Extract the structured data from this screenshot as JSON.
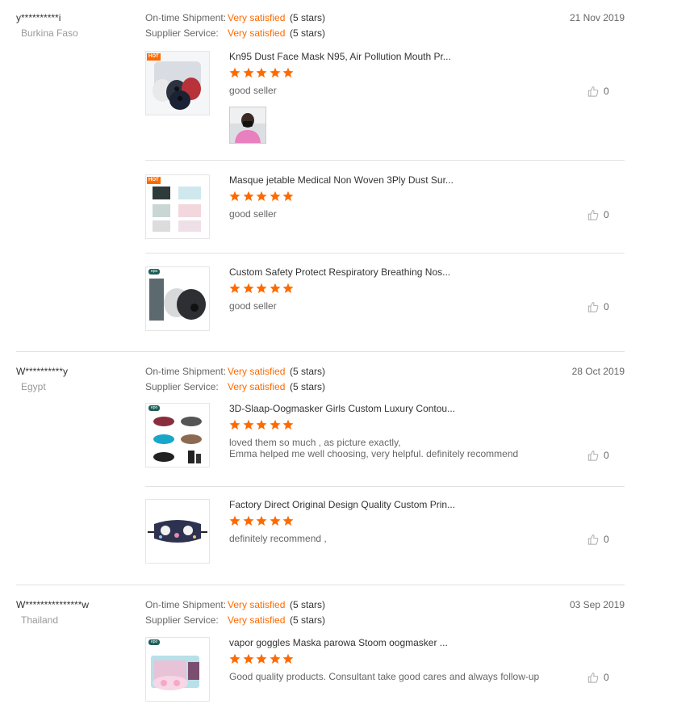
{
  "colors": {
    "accent": "#ff6a00",
    "star": "#ff6a00",
    "divider": "#e2e2e2"
  },
  "reviews": [
    {
      "buyer": "y**********i",
      "country": "Burkina Faso",
      "date": "21 Nov 2019",
      "shipment_label": "On-time Shipment:",
      "shipment_value": "Very satisfied",
      "shipment_stars": "(5 stars)",
      "service_label": "Supplier Service:",
      "service_value": "Very satisfied",
      "service_stars": "(5 stars)",
      "products": [
        {
          "title": "Kn95 Dust Face Mask N95, Air Pollution Mouth Pr...",
          "rating": 5,
          "comment": [
            "good seller"
          ],
          "likes": "0",
          "badge": "HOT",
          "thumb_icon": "face-mask-product-image",
          "has_photo": true
        },
        {
          "title": "Masque jetable Medical Non Woven 3Ply Dust Sur...",
          "rating": 5,
          "comment": [
            "good seller"
          ],
          "likes": "0",
          "badge": "HOT",
          "thumb_icon": "disposable-mask-product-image"
        },
        {
          "title": "Custom Safety Protect Respiratory Breathing Nos...",
          "rating": 5,
          "comment": [
            "good seller"
          ],
          "likes": "0",
          "badge": "epo",
          "thumb_icon": "respirator-mask-product-image"
        }
      ]
    },
    {
      "buyer": "W**********y",
      "country": "Egypt",
      "date": "28 Oct 2019",
      "shipment_label": "On-time Shipment:",
      "shipment_value": "Very satisfied",
      "shipment_stars": "(5 stars)",
      "service_label": "Supplier Service:",
      "service_value": "Very satisfied",
      "service_stars": "(5 stars)",
      "products": [
        {
          "title": "3D-Slaap-Oogmasker Girls Custom Luxury Contou...",
          "rating": 5,
          "comment": [
            "loved them so much , as picture exactly,",
            "Emma helped me well choosing, very helpful. definitely recommend"
          ],
          "likes": "0",
          "badge": "epo",
          "thumb_icon": "sleep-mask-product-image"
        },
        {
          "title": "Factory Direct Original Design Quality Custom Prin...",
          "rating": 5,
          "comment": [
            "definitely recommend ,"
          ],
          "likes": "0",
          "thumb_icon": "printed-eye-mask-product-image"
        }
      ]
    },
    {
      "buyer": "W***************w",
      "country": "Thailand",
      "date": "03 Sep 2019",
      "shipment_label": "On-time Shipment:",
      "shipment_value": "Very satisfied",
      "shipment_stars": "(5 stars)",
      "service_label": "Supplier Service:",
      "service_value": "Very satisfied",
      "service_stars": "(5 stars)",
      "products": [
        {
          "title": "vapor goggles Maska parowa Stoom oogmasker ...",
          "rating": 5,
          "comment": [
            "Good quality products. Consultant take good cares and always follow-up"
          ],
          "likes": "0",
          "badge": "epo",
          "thumb_icon": "steam-eye-mask-product-image"
        }
      ]
    }
  ]
}
